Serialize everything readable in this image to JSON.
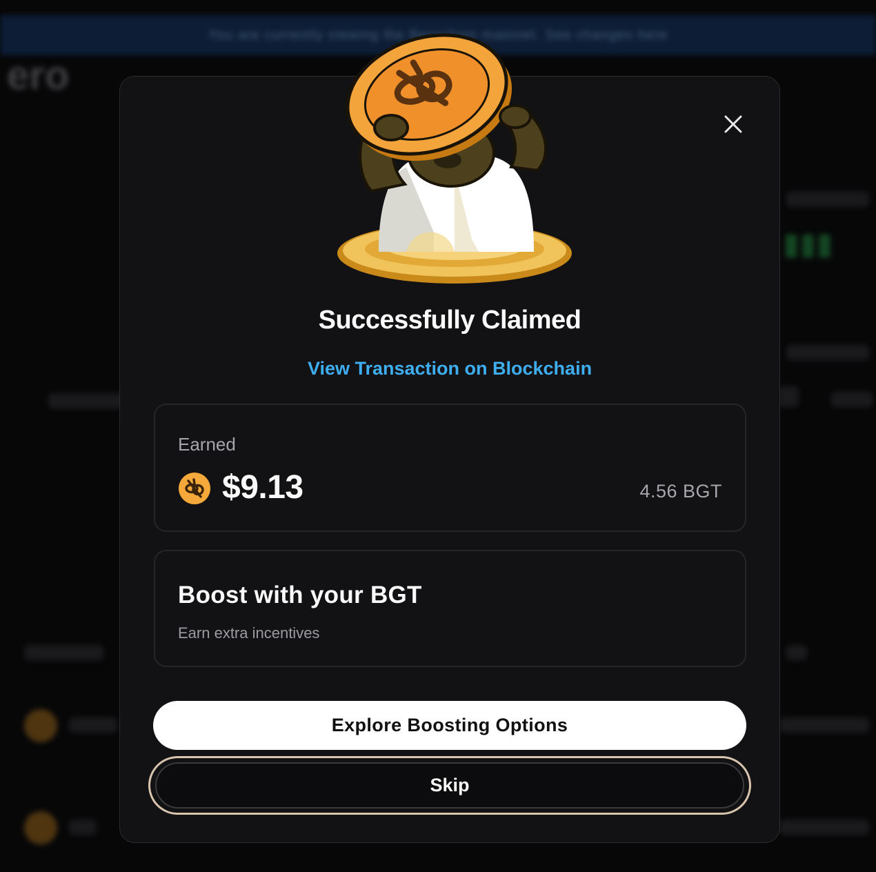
{
  "background": {
    "banner_text": "You are currently viewing the Berachain mainnet. See changes here",
    "logo_text": "ero"
  },
  "modal": {
    "title": "Successfully Claimed",
    "tx_link": "View Transaction on Blockchain",
    "earned": {
      "label": "Earned",
      "usd_value": "$9.13",
      "bgt_amount": "4.56 BGT"
    },
    "boost": {
      "title": "Boost with your BGT",
      "subtitle": "Earn extra incentives"
    },
    "primary_button": "Explore Boosting Options",
    "skip_button": "Skip"
  },
  "colors": {
    "accent_link": "#3eaef0",
    "coin": "#f2a532",
    "skip_ring": "#d9c4ad"
  },
  "icons": [
    "close-icon",
    "bgt-token-icon",
    "bear-coin-mascot"
  ]
}
